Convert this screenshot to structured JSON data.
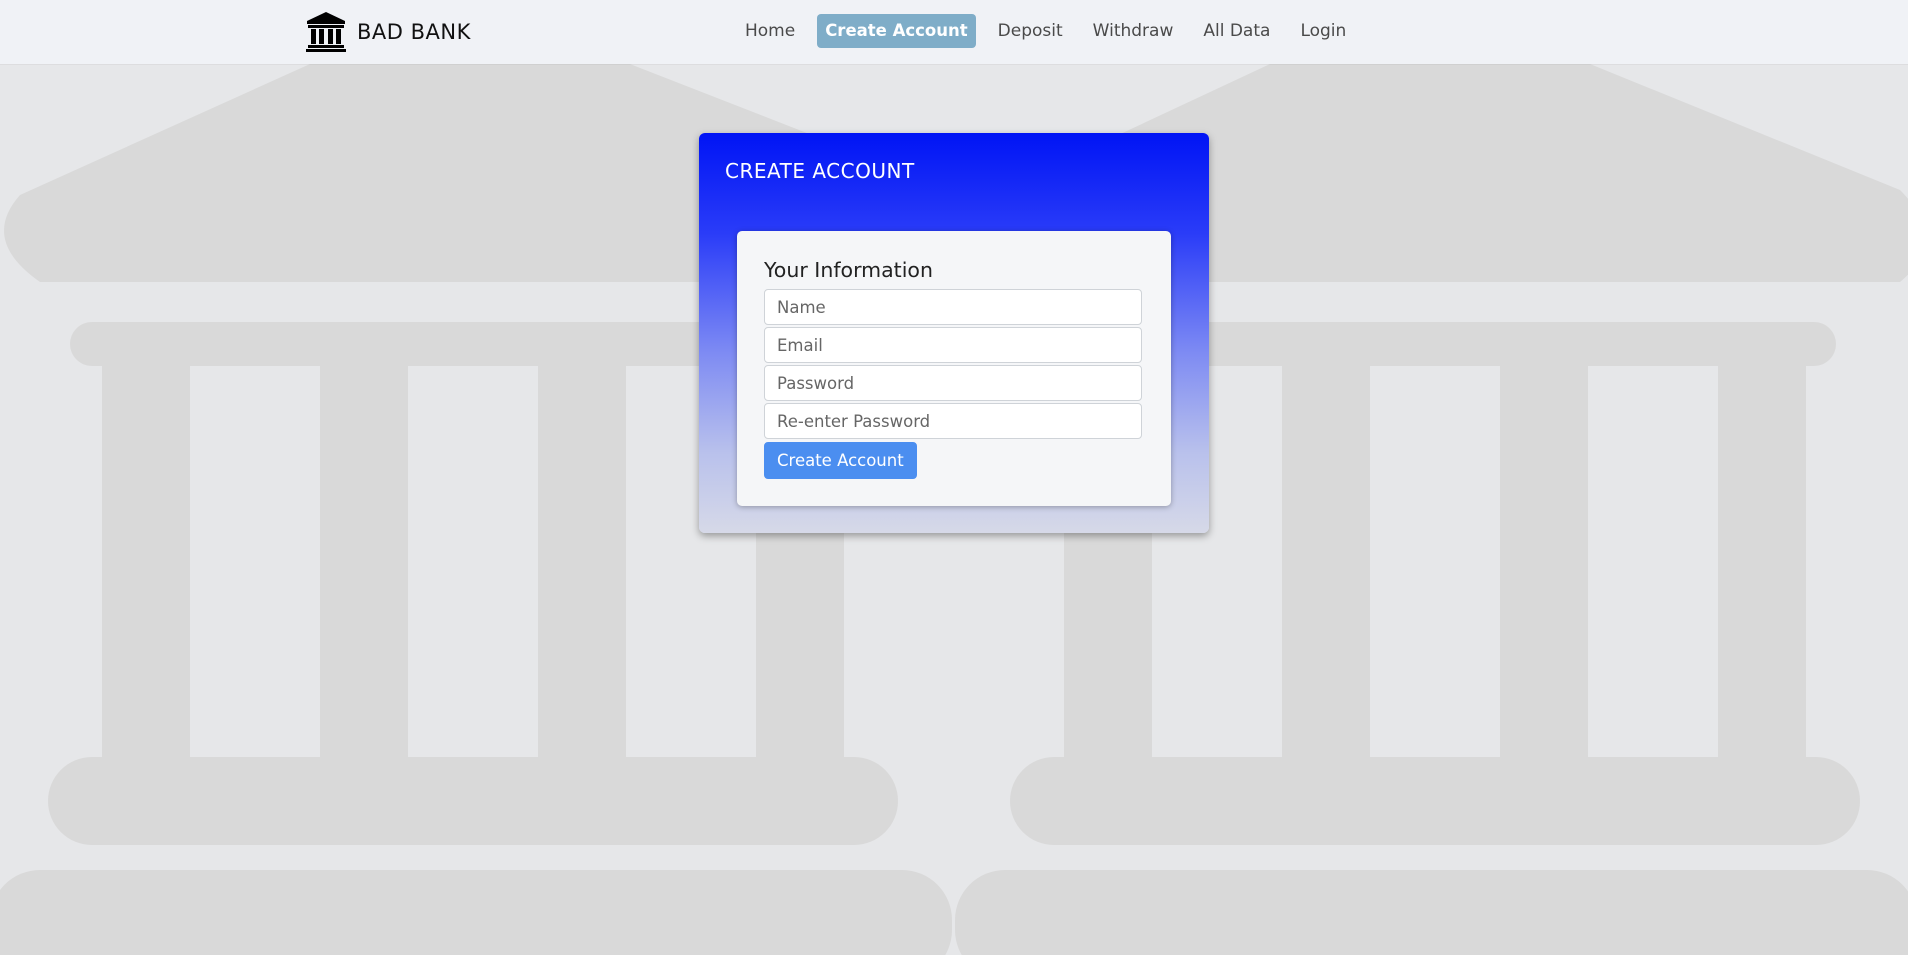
{
  "brand": {
    "name": "BAD BANK",
    "icon": "bank-icon"
  },
  "nav": {
    "items": [
      {
        "label": "Home",
        "active": false
      },
      {
        "label": "Create Account",
        "active": true
      },
      {
        "label": "Deposit",
        "active": false
      },
      {
        "label": "Withdraw",
        "active": false
      },
      {
        "label": "All Data",
        "active": false
      },
      {
        "label": "Login",
        "active": false
      }
    ]
  },
  "card": {
    "title": "CREATE ACCOUNT",
    "form": {
      "heading": "Your Information",
      "fields": {
        "name": {
          "value": "",
          "placeholder": "Name"
        },
        "email": {
          "value": "",
          "placeholder": "Email"
        },
        "password": {
          "value": "",
          "placeholder": "Password"
        },
        "confirm": {
          "value": "",
          "placeholder": "Re-enter Password"
        }
      },
      "submit_label": "Create Account"
    }
  },
  "colors": {
    "navbar_bg": "#f0f2f6",
    "active_tab": "#7fadc8",
    "card_gradient_top": "#0014f5",
    "button": "#4b8ef0",
    "background": "#e5e6e8"
  }
}
